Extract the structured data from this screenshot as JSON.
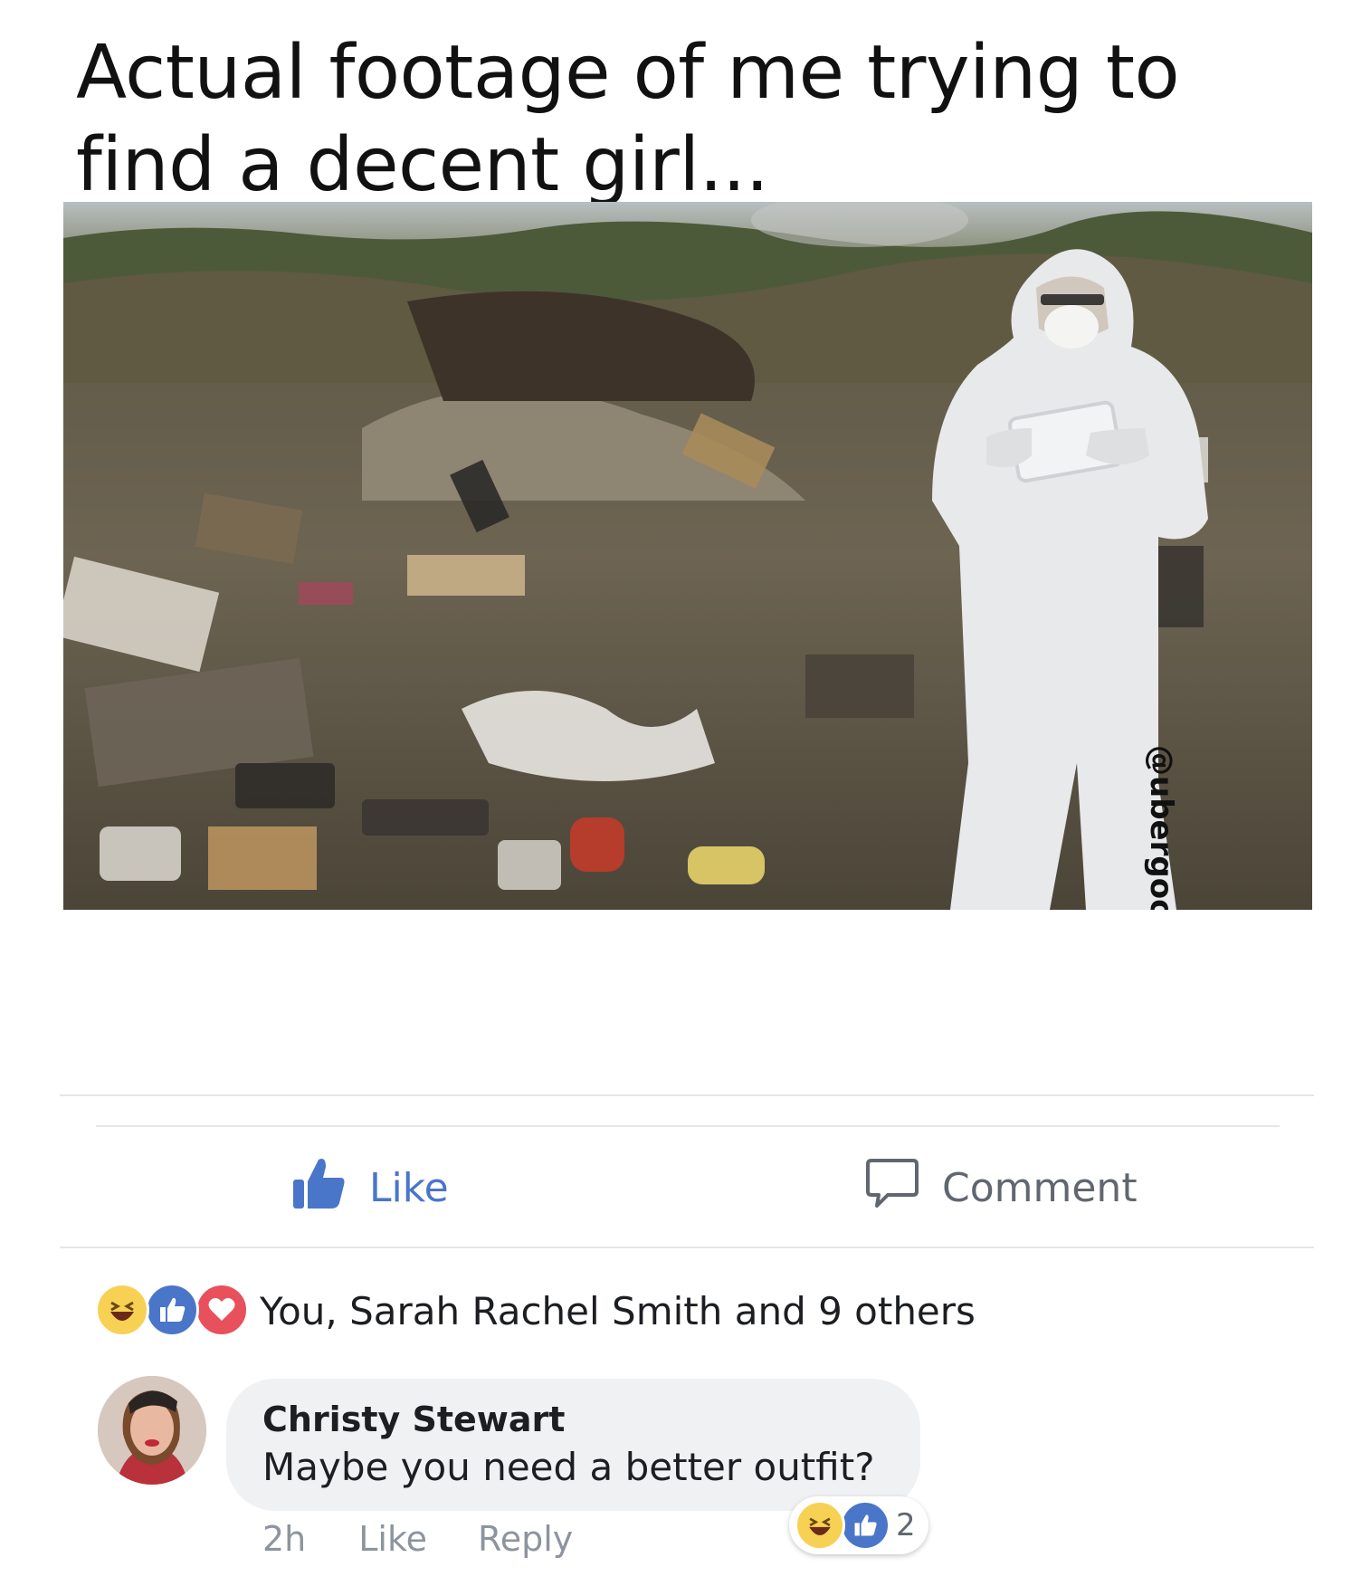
{
  "post": {
    "caption": "Actual footage of me trying to find a decent girl...",
    "image_watermark": "@ubergoobertron"
  },
  "actions": {
    "like_label": "Like",
    "comment_label": "Comment"
  },
  "reactions_summary": {
    "icons": [
      "haha-icon",
      "like-icon",
      "love-icon"
    ],
    "text": "You, Sarah Rachel Smith and 9 others"
  },
  "comment": {
    "author": "Christy Stewart",
    "text": "Maybe you need a better outfit?",
    "time": "2h",
    "like_label": "Like",
    "reply_label": "Reply",
    "reaction_icons": [
      "haha-icon",
      "like-icon"
    ],
    "reaction_count": "2"
  },
  "colors": {
    "facebook_blue": "#4a76c9",
    "love_red": "#e8505b",
    "haha_yellow": "#f7d154",
    "muted_gray": "#8d949e"
  }
}
